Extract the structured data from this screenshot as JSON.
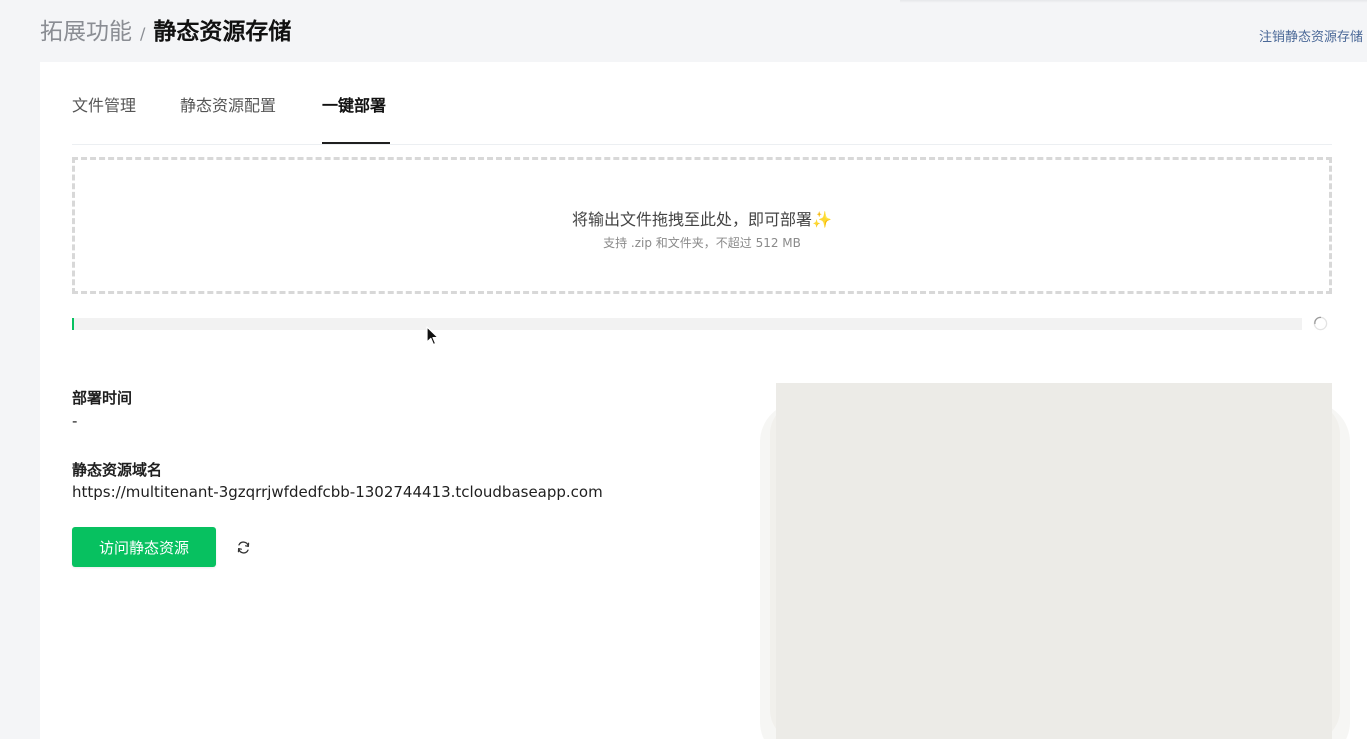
{
  "header": {
    "breadcrumb_parent": "拓展功能",
    "breadcrumb_separator": "/",
    "breadcrumb_current": "静态资源存储",
    "logout_link": "注销静态资源存储"
  },
  "tabs": [
    {
      "label": "文件管理",
      "active": false
    },
    {
      "label": "静态资源配置",
      "active": false
    },
    {
      "label": "一键部署",
      "active": true
    }
  ],
  "dropzone": {
    "title": "将输出文件拖拽至此处，即可部署",
    "title_icon": "sparkles-icon",
    "subtitle": "支持 .zip 和文件夹，不超过 512 MB"
  },
  "progress": {
    "value_percent": 0.2,
    "color": "#07c160",
    "status_icon": "loading-spinner-icon"
  },
  "deploy_info": {
    "deploy_time_label": "部署时间",
    "deploy_time_value": "-",
    "domain_label": "静态资源域名",
    "domain_value": "https://multitenant-3gzqrrjwfdedfcbb-1302744413.tcloudbaseapp.com"
  },
  "actions": {
    "visit_button_label": "访问静态资源",
    "refresh_icon": "refresh-icon"
  },
  "colors": {
    "accent": "#07c160",
    "link": "#4a6897"
  }
}
